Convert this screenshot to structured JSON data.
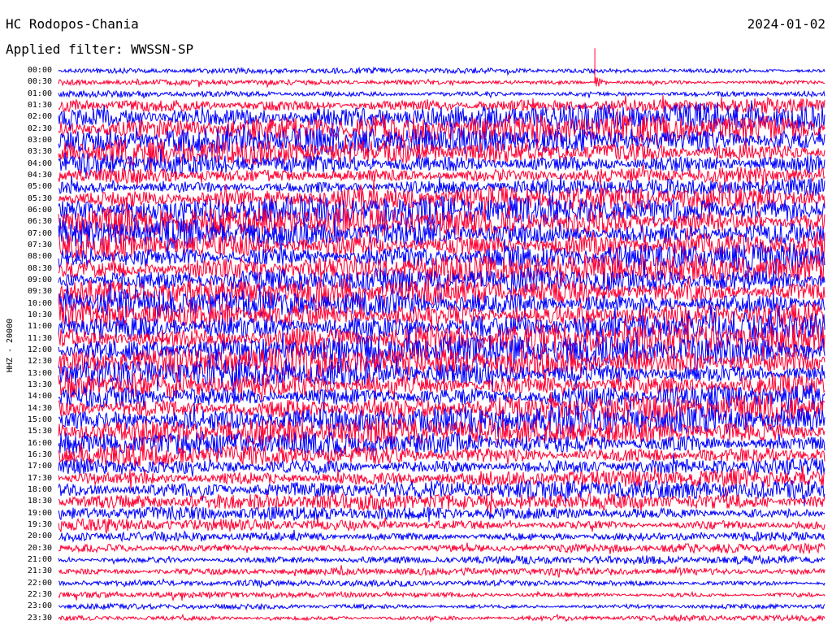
{
  "header": {
    "station": "HC Rodopos-Chania",
    "date": "2024-01-02",
    "filter_text": "Applied filter: WWSSN-SP"
  },
  "chart_data": {
    "type": "line",
    "title": "HC Rodopos-Chania",
    "subtitle": "Applied filter: WWSSN-SP",
    "date": "2024-01-02",
    "channel_label": "HHZ - 20000",
    "row_labels": [
      "00:00",
      "00:30",
      "01:00",
      "01:30",
      "02:00",
      "02:30",
      "03:00",
      "03:30",
      "04:00",
      "04:30",
      "05:00",
      "05:30",
      "06:00",
      "06:30",
      "07:00",
      "07:30",
      "08:00",
      "08:30",
      "09:00",
      "09:30",
      "10:00",
      "10:30",
      "11:00",
      "11:30",
      "12:00",
      "12:30",
      "13:00",
      "13:30",
      "14:00",
      "14:30",
      "15:00",
      "15:30",
      "16:00",
      "16:30",
      "17:00",
      "17:30",
      "18:00",
      "18:30",
      "19:00",
      "19:30",
      "20:00",
      "20:30",
      "21:00",
      "21:30",
      "22:00",
      "22:30",
      "23:00",
      "23:30"
    ],
    "series_colors": [
      "#0000ff",
      "#ff0033"
    ],
    "relative_amplitude": [
      0.45,
      0.45,
      0.55,
      1.3,
      2.2,
      2.3,
      2.2,
      2.1,
      1.8,
      1.5,
      1.4,
      2.0,
      2.4,
      2.5,
      2.5,
      2.4,
      2.3,
      2.4,
      2.0,
      2.2,
      2.3,
      2.5,
      2.6,
      2.5,
      2.5,
      2.4,
      2.2,
      2.2,
      2.1,
      2.2,
      2.3,
      2.2,
      1.9,
      1.8,
      1.5,
      1.5,
      1.6,
      1.4,
      1.1,
      1.0,
      0.9,
      0.8,
      0.7,
      0.6,
      0.5,
      0.5,
      0.5,
      0.5
    ],
    "events": [
      {
        "row": 1,
        "position": 0.7,
        "amplitude": 6
      }
    ]
  }
}
